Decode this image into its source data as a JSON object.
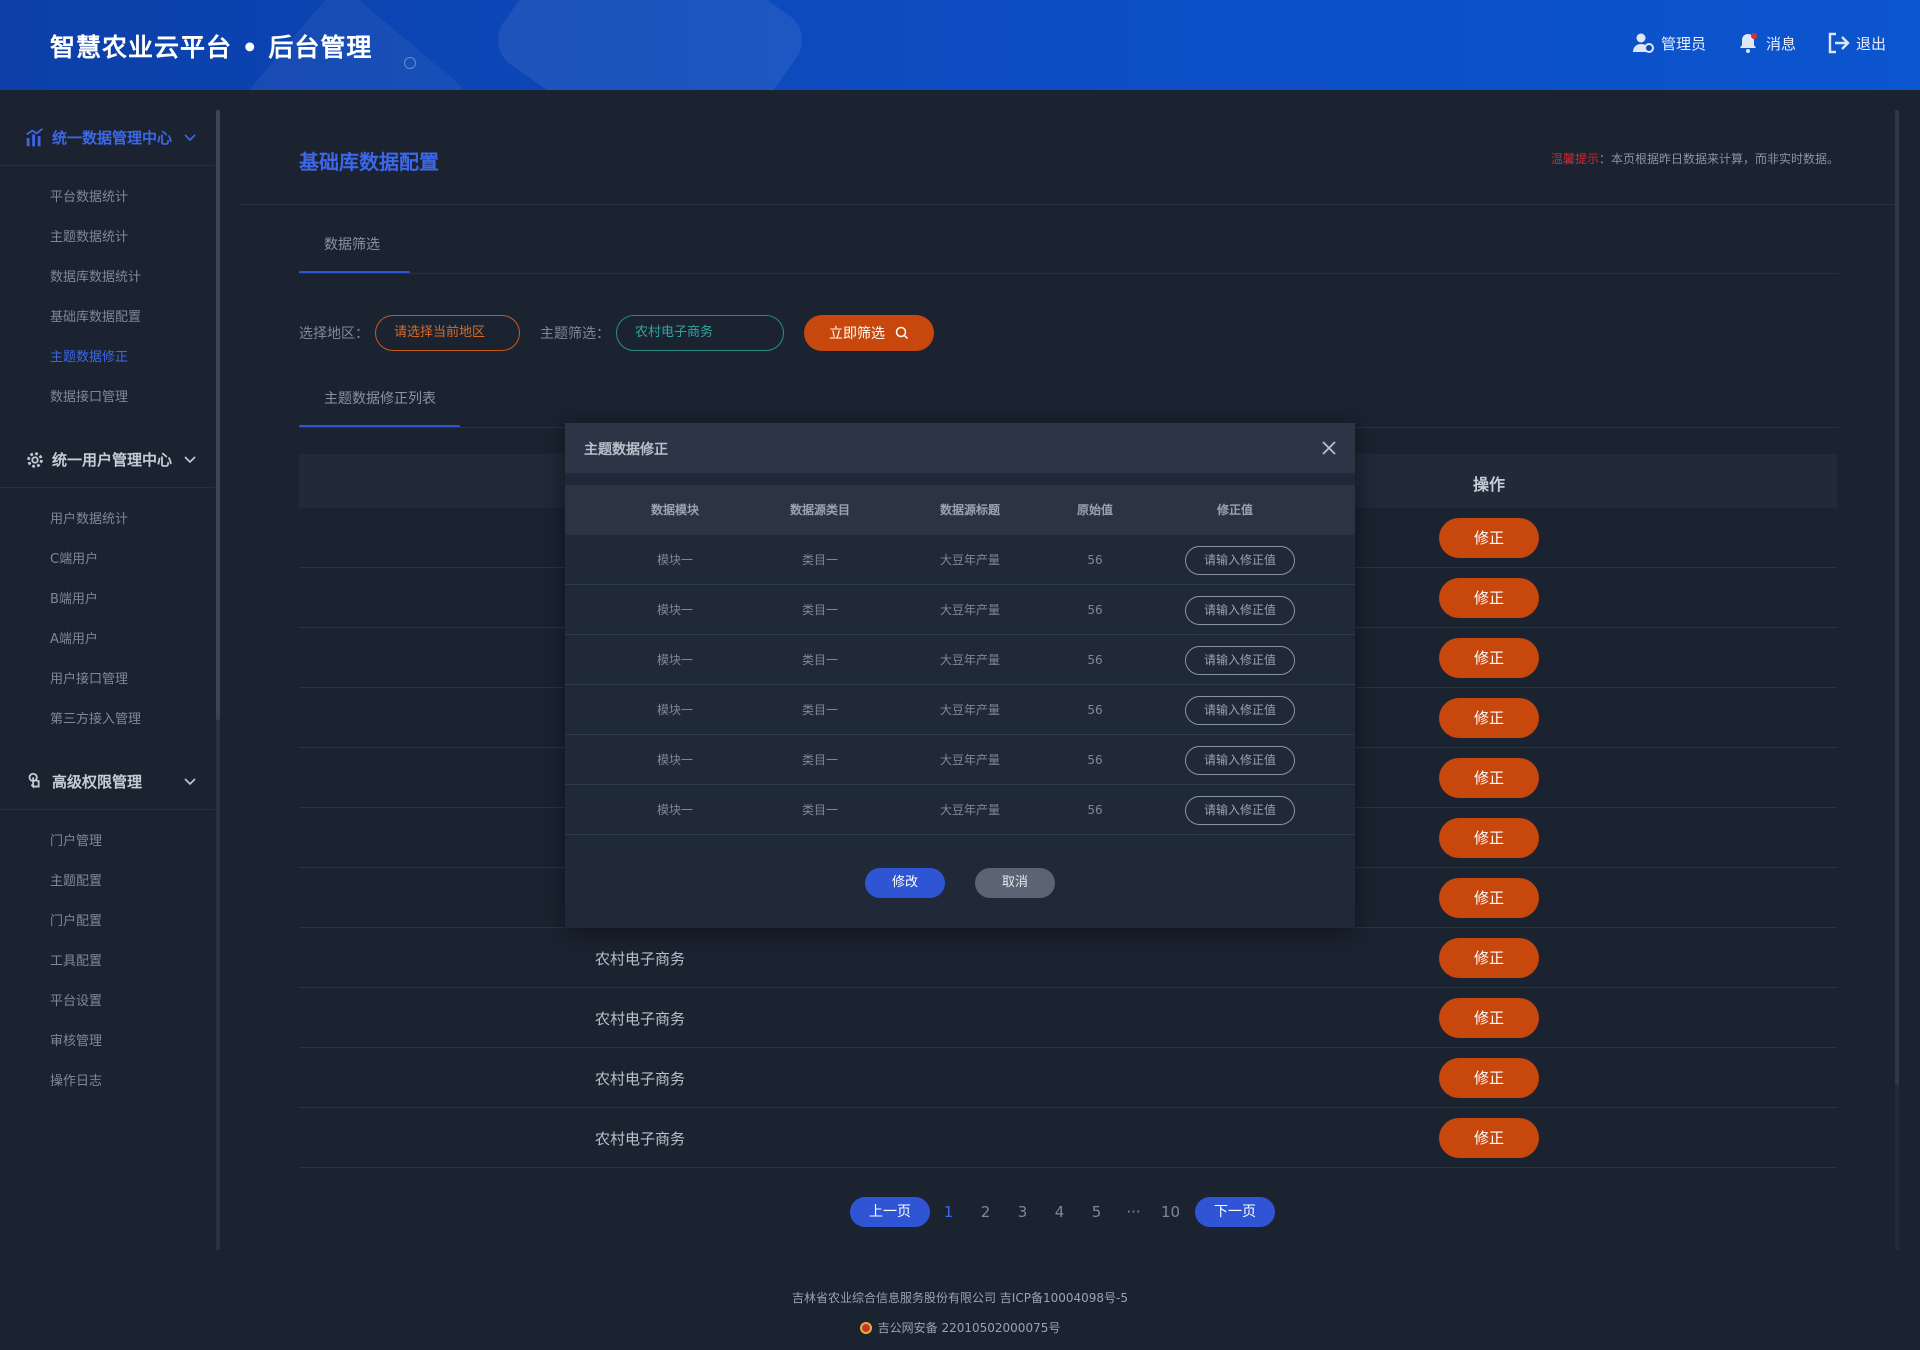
{
  "header": {
    "title": "智慧农业云平台 • 后台管理",
    "actions": [
      {
        "label": "管理员",
        "icon": "user-gear-icon"
      },
      {
        "label": "消息",
        "icon": "bell-icon"
      },
      {
        "label": "退出",
        "icon": "logout-icon"
      }
    ]
  },
  "sidebar": {
    "groups": [
      {
        "title": "统一数据管理中心",
        "icon": "chart-icon",
        "items": [
          "平台数据统计",
          "主题数据统计",
          "数据库数据统计",
          "基础库数据配置",
          "主题数据修正",
          "数据接口管理"
        ]
      },
      {
        "title": "统一用户管理中心",
        "icon": "gear-icon",
        "items": [
          "用户数据统计",
          "C端用户",
          "B端用户",
          "A端用户",
          "用户接口管理",
          "第三方接入管理"
        ]
      },
      {
        "title": "高级权限管理",
        "icon": "touch-icon",
        "items": [
          "门户管理",
          "主题配置",
          "门户配置",
          "工具配置",
          "平台设置",
          "审核管理",
          "操作日志"
        ]
      }
    ],
    "active_item": "主题数据修正"
  },
  "page": {
    "title": "基础库数据配置",
    "notice_prefix": "温馨提示",
    "notice_text": "：本页根据昨日数据来计算，而非实时数据。",
    "filter_tab": "数据筛选",
    "filter": {
      "region_label": "选择地区：",
      "region_value": "请选择当前地区",
      "topic_label": "主题筛选：",
      "topic_value": "农村电子商务",
      "submit_label": "立即筛选"
    },
    "list_tab": "主题数据修正列表",
    "table": {
      "op_header": "操作",
      "rows": [
        "",
        "",
        "",
        "",
        "",
        "",
        "",
        "农村电子商务",
        "农村电子商务",
        "农村电子商务",
        "农村电子商务"
      ],
      "fix_label": "修正"
    },
    "pagination": {
      "prev": "上一页",
      "pages": [
        "1",
        "2",
        "3",
        "4",
        "5",
        "···",
        "10"
      ],
      "current": "1",
      "next": "下一页"
    }
  },
  "footer": {
    "line1": "吉林省农业综合信息服务股份有限公司    吉ICP备10004098号-5",
    "line2": "吉公网安备 22010502000075号"
  },
  "modal": {
    "title": "主题数据修正",
    "columns": [
      "数据模块",
      "数据源类目",
      "数据源标题",
      "原始值",
      "修正值"
    ],
    "rows": [
      {
        "module": "模块一",
        "category": "类目一",
        "source_title": "大豆年产量",
        "original": "56",
        "placeholder": "请输入修正值"
      },
      {
        "module": "模块一",
        "category": "类目一",
        "source_title": "大豆年产量",
        "original": "56",
        "placeholder": "请输入修正值"
      },
      {
        "module": "模块一",
        "category": "类目一",
        "source_title": "大豆年产量",
        "original": "56",
        "placeholder": "请输入修正值"
      },
      {
        "module": "模块一",
        "category": "类目一",
        "source_title": "大豆年产量",
        "original": "56",
        "placeholder": "请输入修正值"
      },
      {
        "module": "模块一",
        "category": "类目一",
        "source_title": "大豆年产量",
        "original": "56",
        "placeholder": "请输入修正值"
      },
      {
        "module": "模块一",
        "category": "类目一",
        "source_title": "大豆年产量",
        "original": "56",
        "placeholder": "请输入修正值"
      }
    ],
    "ok_label": "修改",
    "cancel_label": "取消"
  },
  "colors": {
    "accent_blue": "#2f55d4",
    "accent_orange": "#c8470d",
    "teal": "#31a59f",
    "warn_red": "#d8262b"
  }
}
